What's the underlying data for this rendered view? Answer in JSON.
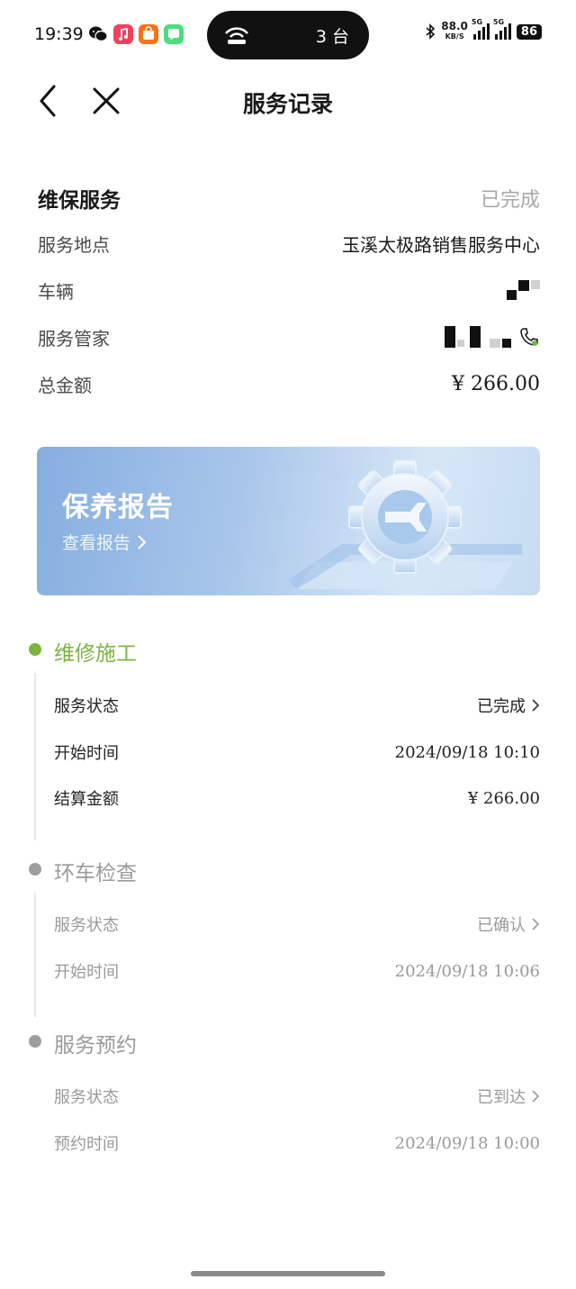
{
  "status_bar": {
    "time": "19:39",
    "pill_text": "3 台",
    "net_speed_value": "88.0",
    "net_speed_unit": "KB/S",
    "signal_label_1": "5G",
    "signal_label_2": "5G",
    "battery": "86"
  },
  "nav": {
    "title": "服务记录"
  },
  "summary": {
    "title": "维保服务",
    "status": "已完成",
    "rows": [
      {
        "label": "服务地点",
        "value": "玉溪太极路销售服务中心"
      },
      {
        "label": "车辆",
        "value": ""
      },
      {
        "label": "服务管家",
        "value": ""
      },
      {
        "label": "总金额",
        "value": "¥ 266.00"
      }
    ]
  },
  "banner": {
    "title": "保养报告",
    "link": "查看报告"
  },
  "timeline": [
    {
      "title": "维修施工",
      "state": "active",
      "color": "#7cb342",
      "rows": [
        {
          "label": "服务状态",
          "value": "已完成",
          "chevron": true
        },
        {
          "label": "开始时间",
          "value": "2024/09/18 10:10",
          "chevron": false
        },
        {
          "label": "结算金额",
          "value": "¥ 266.00",
          "chevron": false
        }
      ]
    },
    {
      "title": "环车检查",
      "state": "muted",
      "color": "#9e9e9e",
      "rows": [
        {
          "label": "服务状态",
          "value": "已确认",
          "chevron": true
        },
        {
          "label": "开始时间",
          "value": "2024/09/18 10:06",
          "chevron": false
        }
      ]
    },
    {
      "title": "服务预约",
      "state": "muted",
      "color": "#9e9e9e",
      "rows": [
        {
          "label": "服务状态",
          "value": "已到达",
          "chevron": true
        },
        {
          "label": "预约时间",
          "value": "2024/09/18 10:00",
          "chevron": false
        }
      ]
    }
  ],
  "colors": {
    "accent_green": "#7cb342",
    "muted_gray": "#9e9e9e"
  }
}
